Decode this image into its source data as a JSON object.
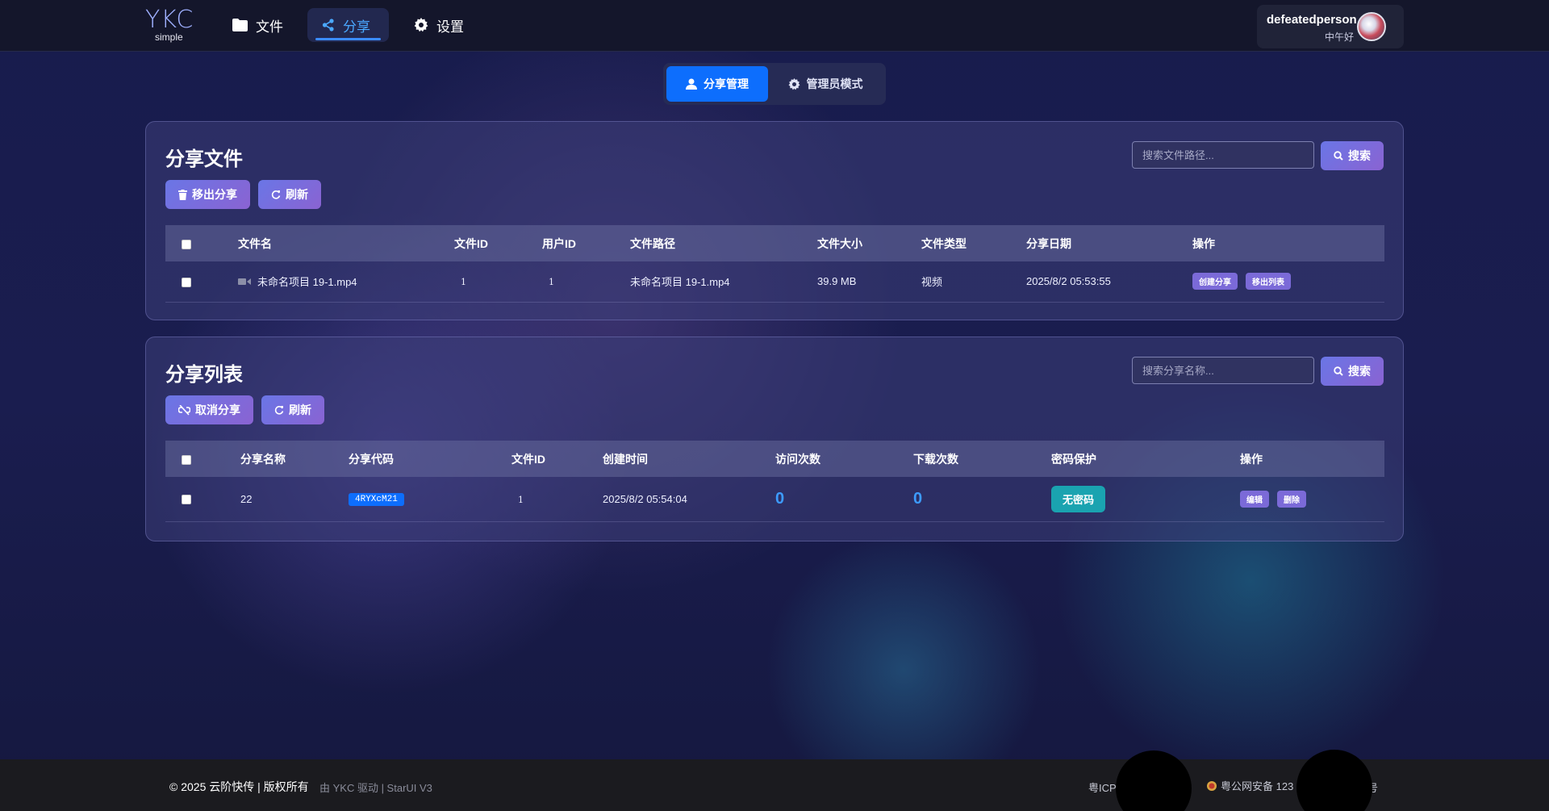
{
  "brand": {
    "logo": "YKC",
    "sub": "simple"
  },
  "nav": {
    "file": "文件",
    "share": "分享",
    "settings": "设置"
  },
  "user": {
    "name": "defeatedperson",
    "greeting": "中午好"
  },
  "modes": {
    "share_manage": "分享管理",
    "admin": "管理员模式"
  },
  "share_files": {
    "title": "分享文件",
    "remove_btn": "移出分享",
    "refresh_btn": "刷新",
    "search_placeholder": "搜索文件路径...",
    "search_btn": "搜索",
    "columns": [
      "文件名",
      "文件ID",
      "用户ID",
      "文件路径",
      "文件大小",
      "文件类型",
      "分享日期",
      "操作"
    ],
    "rows": [
      {
        "name": "未命名项目 19-1.mp4",
        "file_id": "1",
        "user_id": "1",
        "path": "未命名项目 19-1.mp4",
        "size": "39.9 MB",
        "type": "视频",
        "date": "2025/8/2 05:53:55",
        "create_btn": "创建分享",
        "remove_btn": "移出列表"
      }
    ]
  },
  "share_list": {
    "title": "分享列表",
    "cancel_btn": "取消分享",
    "refresh_btn": "刷新",
    "search_placeholder": "搜索分享名称...",
    "search_btn": "搜索",
    "columns": [
      "分享名称",
      "分享代码",
      "文件ID",
      "创建时间",
      "访问次数",
      "下载次数",
      "密码保护",
      "操作"
    ],
    "rows": [
      {
        "name": "22",
        "code": "4RYXcM21",
        "file_id": "1",
        "created": "2025/8/2 05:54:04",
        "visits": "0",
        "downloads": "0",
        "password": "无密码",
        "edit_btn": "编辑",
        "delete_btn": "删除"
      }
    ]
  },
  "footer": {
    "copyright": "© 2025 云阶快传 | 版权所有",
    "powered": "由 YKC 驱动 | StarUI V3",
    "icp": "粤ICP",
    "police": "粤公网安备 123",
    "police_tail": "号"
  },
  "colors": {
    "accent": "#0d6efd",
    "button": "#7b6ad8",
    "teal": "#1aa3b0"
  }
}
